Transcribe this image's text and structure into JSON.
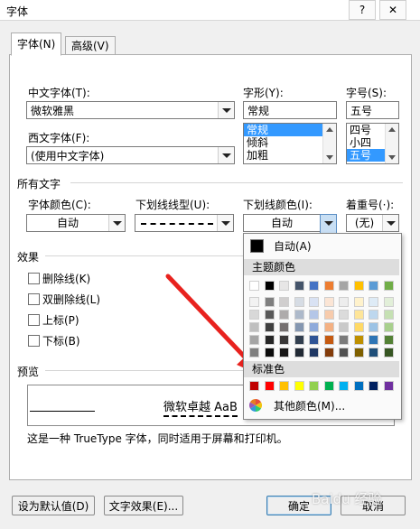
{
  "window": {
    "title": "字体",
    "help": "?",
    "close": "✕"
  },
  "tabs": [
    {
      "label": "字体(N)",
      "active": true
    },
    {
      "label": "高级(V)",
      "active": false
    }
  ],
  "font": {
    "cn_font_label": "中文字体(T):",
    "cn_font_value": "微软雅黑",
    "west_font_label": "西文字体(F):",
    "west_font_value": "(使用中文字体)",
    "style_label": "字形(Y):",
    "style_value": "常规",
    "style_options": [
      "常规",
      "倾斜",
      "加粗"
    ],
    "size_label": "字号(S):",
    "size_value": "五号",
    "size_options": [
      "四号",
      "小四",
      "五号"
    ]
  },
  "all_text": {
    "section_label": "所有文字",
    "font_color_label": "字体颜色(C):",
    "font_color_value": "自动",
    "underline_type_label": "下划线线型(U):",
    "underline_color_label": "下划线颜色(I):",
    "underline_color_value": "自动",
    "emphasis_label": "着重号(·):",
    "emphasis_value": "(无)"
  },
  "effects": {
    "section_label": "效果",
    "items": [
      "删除线(K)",
      "双删除线(L)",
      "上标(P)",
      "下标(B)"
    ]
  },
  "preview": {
    "section_label": "预览",
    "sample_text": "微软卓越  AaB",
    "description": "这是一种 TrueType 字体，同时适用于屏幕和打印机。"
  },
  "buttons": {
    "set_default": "设为默认值(D)",
    "text_effects": "文字效果(E)...",
    "ok": "确定",
    "cancel": "取消"
  },
  "color_popup": {
    "auto_label": "自动(A)",
    "theme_label": "主题颜色",
    "standard_label": "标准色",
    "more_label": "其他颜色(M)...",
    "theme_top_row": [
      "#ffffff",
      "#000000",
      "#eeece1",
      "#1f497d",
      "#4f81bd",
      "#c0504d",
      "#9bbb59",
      "#8064a2",
      "#4bacc6",
      "#f79646"
    ],
    "theme_top_row_shown": [
      "#ffffff",
      "#000000",
      "#e7e6e6",
      "#44546a",
      "#4472c4",
      "#ed7d31",
      "#a5a5a5",
      "#ffc000",
      "#5b9bd5",
      "#70ad47"
    ],
    "theme_shades": [
      [
        "#f2f2f2",
        "#7f7f7f",
        "#d0cece",
        "#d6dce4",
        "#d9e2f3",
        "#fbe5d5",
        "#ededed",
        "#fff2cc",
        "#deebf6",
        "#e2efd9"
      ],
      [
        "#d8d8d8",
        "#595959",
        "#aeabab",
        "#adb9ca",
        "#b4c6e7",
        "#f7cbac",
        "#dbdbdb",
        "#fee599",
        "#bdd7ee",
        "#c5e0b3"
      ],
      [
        "#bfbfbf",
        "#3f3f3f",
        "#757070",
        "#8496b0",
        "#8eaadb",
        "#f4b183",
        "#c9c9c9",
        "#ffd965",
        "#9cc3e5",
        "#a8d08d"
      ],
      [
        "#a5a5a5",
        "#262626",
        "#3a3838",
        "#323f4f",
        "#2f5496",
        "#c55a11",
        "#7b7b7b",
        "#bf9000",
        "#2e75b5",
        "#538135"
      ],
      [
        "#7f7f7f",
        "#0c0c0c",
        "#171616",
        "#222a35",
        "#1f3864",
        "#833c0b",
        "#525252",
        "#7f6000",
        "#1e4e79",
        "#375623"
      ]
    ],
    "standard_colors": [
      "#c00000",
      "#ff0000",
      "#ffc000",
      "#ffff00",
      "#92d050",
      "#00b050",
      "#00b0f0",
      "#0070c0",
      "#002060",
      "#7030a0"
    ]
  },
  "watermark": "Baidu 经验"
}
